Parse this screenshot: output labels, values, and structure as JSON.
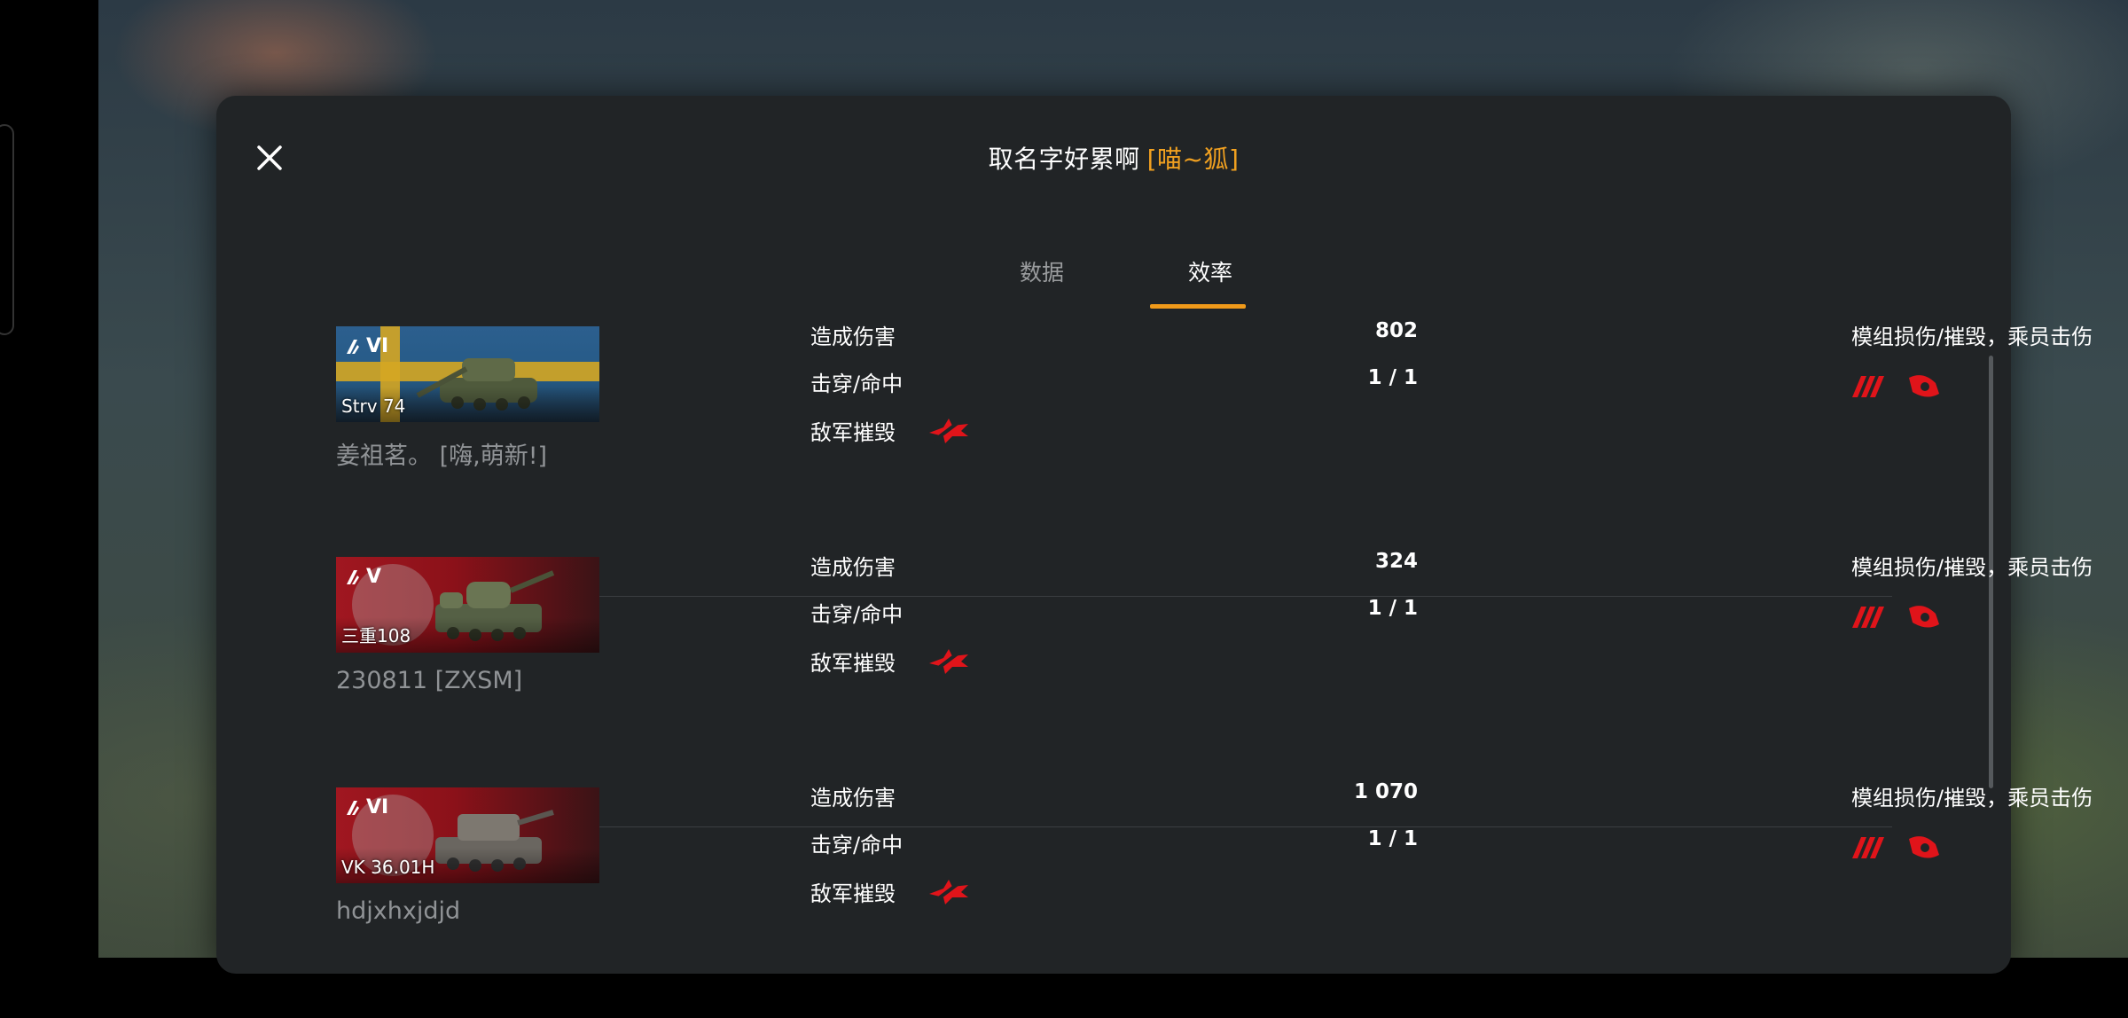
{
  "header": {
    "title": "取名字好累啊",
    "clan_tag": "[喵~狐]"
  },
  "tabs": [
    {
      "label": "数据",
      "active": false
    },
    {
      "label": "效率",
      "active": true
    }
  ],
  "colors": {
    "accent": "#f09a1a",
    "clan": "#f0a020",
    "icon_red": "#e0141a"
  },
  "labels": {
    "damage": "造成伤害",
    "pen_hit": "击穿/命中",
    "kill": "敌军摧毁",
    "module": "模组损伤/摧毁，乘员击伤"
  },
  "rows": [
    {
      "tier": "VI",
      "tank_name": "Strv 74",
      "nation": "sweden",
      "player": "姜祖茗。 [嗨,萌新!]",
      "damage": "802",
      "pen_hit": "1 / 1"
    },
    {
      "tier": "V",
      "tank_name": "三重108",
      "nation": "china",
      "player": "230811 [ZXSM]",
      "damage": "324",
      "pen_hit": "1 / 1"
    },
    {
      "tier": "VI",
      "tank_name": "VK 36.01H",
      "nation": "germany",
      "player": "hdjxhxjdjd",
      "damage": "1 070",
      "pen_hit": "1 / 1"
    }
  ]
}
